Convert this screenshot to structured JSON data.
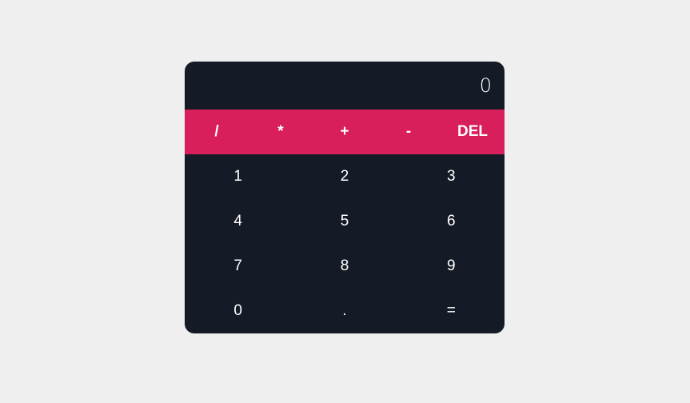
{
  "display": {
    "value": "0"
  },
  "operators": [
    {
      "label": "/",
      "name": "divide-button"
    },
    {
      "label": "*",
      "name": "multiply-button"
    },
    {
      "label": "+",
      "name": "add-button"
    },
    {
      "label": "-",
      "name": "subtract-button"
    },
    {
      "label": "DEL",
      "name": "delete-button"
    }
  ],
  "digits": [
    {
      "label": "1",
      "name": "digit-1-button"
    },
    {
      "label": "2",
      "name": "digit-2-button"
    },
    {
      "label": "3",
      "name": "digit-3-button"
    },
    {
      "label": "4",
      "name": "digit-4-button"
    },
    {
      "label": "5",
      "name": "digit-5-button"
    },
    {
      "label": "6",
      "name": "digit-6-button"
    },
    {
      "label": "7",
      "name": "digit-7-button"
    },
    {
      "label": "8",
      "name": "digit-8-button"
    },
    {
      "label": "9",
      "name": "digit-9-button"
    },
    {
      "label": "0",
      "name": "digit-0-button"
    },
    {
      "label": ".",
      "name": "decimal-button"
    },
    {
      "label": "=",
      "name": "equals-button"
    }
  ],
  "colors": {
    "page_background": "#efefef",
    "calculator_background": "#141a26",
    "operator_bar": "#d81e5b",
    "text": "#ffffff"
  }
}
